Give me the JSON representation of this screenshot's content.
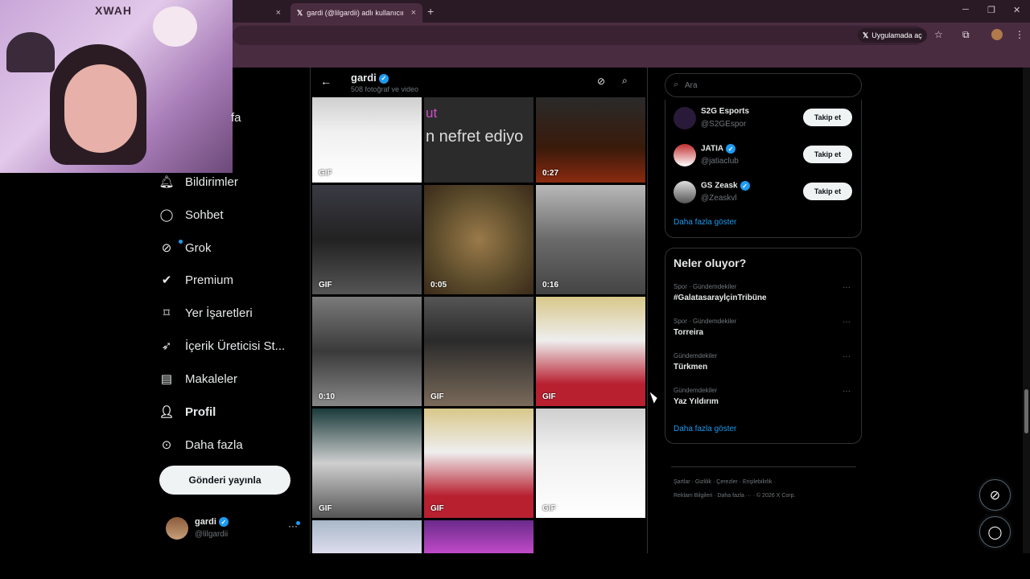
{
  "browser": {
    "tab1_close": "×",
    "active_tab": {
      "title": "gardi (@lilgardii) adlı kullanıcının",
      "close": "×"
    },
    "new_tab": "+",
    "open_in_app": "Uygulamada aç",
    "window": {
      "minimize": "─",
      "restore": "❐",
      "close": "✕"
    },
    "colors": {
      "frame": "#2a1a26",
      "toolbar": "#4a2c40"
    }
  },
  "webcam": {
    "brand": "XWAH"
  },
  "sidebar": {
    "partial_label": "fa",
    "items": [
      {
        "label": "Bildirimler",
        "icon": "bell-icon"
      },
      {
        "label": "Sohbet",
        "icon": "chat-icon"
      },
      {
        "label": "Grok",
        "icon": "grok-icon"
      },
      {
        "label": "Premium",
        "icon": "premium-icon"
      },
      {
        "label": "Yer İşaretleri",
        "icon": "bookmark-icon"
      },
      {
        "label": "İçerik Üreticisi St...",
        "icon": "rocket-icon"
      },
      {
        "label": "Makaleler",
        "icon": "articles-icon"
      },
      {
        "label": "Profil",
        "icon": "profile-icon"
      },
      {
        "label": "Daha fazla",
        "icon": "more-circle-icon"
      }
    ],
    "post_button": "Gönderi yayınla",
    "account": {
      "name": "gardi",
      "handle": "@lilgardii",
      "more": "···"
    }
  },
  "media": {
    "profile_name": "gardi",
    "subtitle": "508 fotoğraf ve video",
    "tiles": [
      {
        "badge": "GIF",
        "overlay": ""
      },
      {
        "badge": "",
        "overlay": "n nefret ediyo",
        "overlay2": "ut"
      },
      {
        "badge": "0:27",
        "overlay": ""
      },
      {
        "badge": "GIF",
        "overlay": ""
      },
      {
        "badge": "0:05",
        "overlay": ""
      },
      {
        "badge": "0:16",
        "overlay": ""
      },
      {
        "badge": "0:10",
        "overlay": ""
      },
      {
        "badge": "GIF",
        "overlay": ""
      },
      {
        "badge": "GIF",
        "overlay": ""
      },
      {
        "badge": "GIF",
        "overlay": ""
      },
      {
        "badge": "GIF",
        "overlay": ""
      },
      {
        "badge": "GIF",
        "overlay": ""
      },
      {
        "badge": "",
        "overlay": ""
      },
      {
        "badge": "",
        "overlay": ""
      }
    ]
  },
  "right": {
    "search_placeholder": "Ara",
    "who_to_follow": [
      {
        "name": "S2G Esports",
        "handle": "@S2GEspor",
        "verified": false,
        "follow": "Takip et"
      },
      {
        "name": "JATIA",
        "handle": "@jatiaclub",
        "verified": true,
        "follow": "Takip et"
      },
      {
        "name": "GS Zeask",
        "handle": "@Zeaskvl",
        "verified": true,
        "follow": "Takip et"
      }
    ],
    "show_more_1": "Daha fazla göster",
    "trends_title": "Neler oluyor?",
    "trends": [
      {
        "context": "Spor · Gündemdekiler",
        "title": "#GalatasarayİçinTribüne"
      },
      {
        "context": "Spor · Gündemdekiler",
        "title": "Torreira"
      },
      {
        "context": "Gündemdekiler",
        "title": "Türkmen"
      },
      {
        "context": "Gündemdekiler",
        "title": "Yaz Yıldırım"
      }
    ],
    "trend_more": "···",
    "show_more_2": "Daha fazla göster",
    "footer_line1": "Şartlar  ·  Gizlilik  ·  Çerezler  ·  Erişilebilirlik  ·",
    "footer_line2": "Reklam Bilgileri  ·  Daha fazla ···  ·  © 2026 X Corp."
  }
}
